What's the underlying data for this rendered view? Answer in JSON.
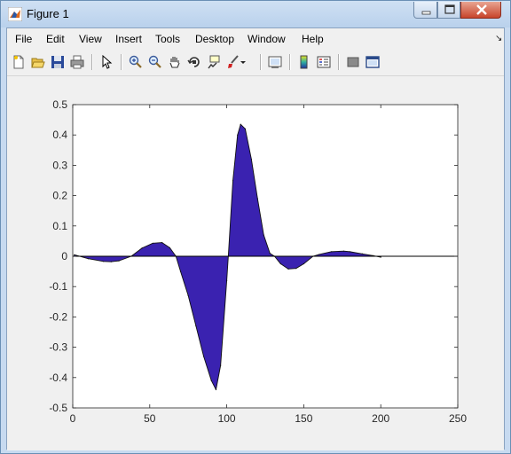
{
  "window": {
    "title": "Figure 1",
    "app_icon": "matlab-icon"
  },
  "titlebar_buttons": [
    "minimize-icon",
    "maximize-icon",
    "close-icon"
  ],
  "menu": {
    "items": [
      "File",
      "Edit",
      "View",
      "Insert",
      "Tools",
      "Desktop",
      "Window",
      "Help"
    ],
    "dock_arrow": "↘"
  },
  "toolbar": {
    "icons": [
      "new-figure-icon",
      "open-file-icon",
      "save-icon",
      "print-icon",
      "edit-plot-arrow-icon",
      "zoom-in-icon",
      "zoom-out-icon",
      "pan-hand-icon",
      "rotate-3d-icon",
      "data-cursor-icon",
      "brush-icon",
      "brush-dropdown-icon",
      "link-plot-icon",
      "colorbar-icon",
      "legend-icon",
      "hide-plot-tools-icon",
      "show-plot-tools-icon"
    ]
  },
  "colors": {
    "fill": "#3a22b0",
    "axes_bg": "#ffffff",
    "figure_bg": "#f0f0f0"
  },
  "chart_data": {
    "type": "area",
    "title": "",
    "xlabel": "",
    "ylabel": "",
    "xlim": [
      0,
      250
    ],
    "ylim": [
      -0.5,
      0.5
    ],
    "xticks": [
      0,
      50,
      100,
      150,
      200,
      250
    ],
    "yticks": [
      -0.5,
      -0.4,
      -0.3,
      -0.2,
      -0.1,
      0,
      0.1,
      0.2,
      0.3,
      0.4,
      0.5
    ],
    "xtick_labels": [
      "0",
      "50",
      "100",
      "150",
      "200",
      "250"
    ],
    "ytick_labels": [
      "-0.5",
      "-0.4",
      "-0.3",
      "-0.2",
      "-0.1",
      "0",
      "0.1",
      "0.2",
      "0.3",
      "0.4",
      "0.5"
    ],
    "grid": false,
    "baseline": 0,
    "series": [
      {
        "x": [
          1,
          10,
          20,
          25,
          30,
          38,
          45,
          52,
          58,
          63,
          67,
          70,
          75,
          80,
          85,
          90,
          93,
          96,
          100,
          101,
          104,
          107,
          109,
          112,
          116,
          120,
          124,
          128,
          131,
          135,
          140,
          145,
          150,
          156,
          160,
          168,
          176,
          180,
          188,
          195,
          200
        ],
        "y": [
          0.005,
          -0.008,
          -0.017,
          -0.018,
          -0.015,
          0,
          0.027,
          0.043,
          0.045,
          0.028,
          0,
          -0.05,
          -0.13,
          -0.23,
          -0.33,
          -0.41,
          -0.44,
          -0.36,
          -0.08,
          0,
          0.25,
          0.4,
          0.435,
          0.42,
          0.32,
          0.19,
          0.07,
          0.01,
          0,
          -0.025,
          -0.042,
          -0.04,
          -0.025,
          0,
          0.006,
          0.015,
          0.017,
          0.015,
          0.008,
          0.002,
          -0.003
        ]
      }
    ]
  }
}
